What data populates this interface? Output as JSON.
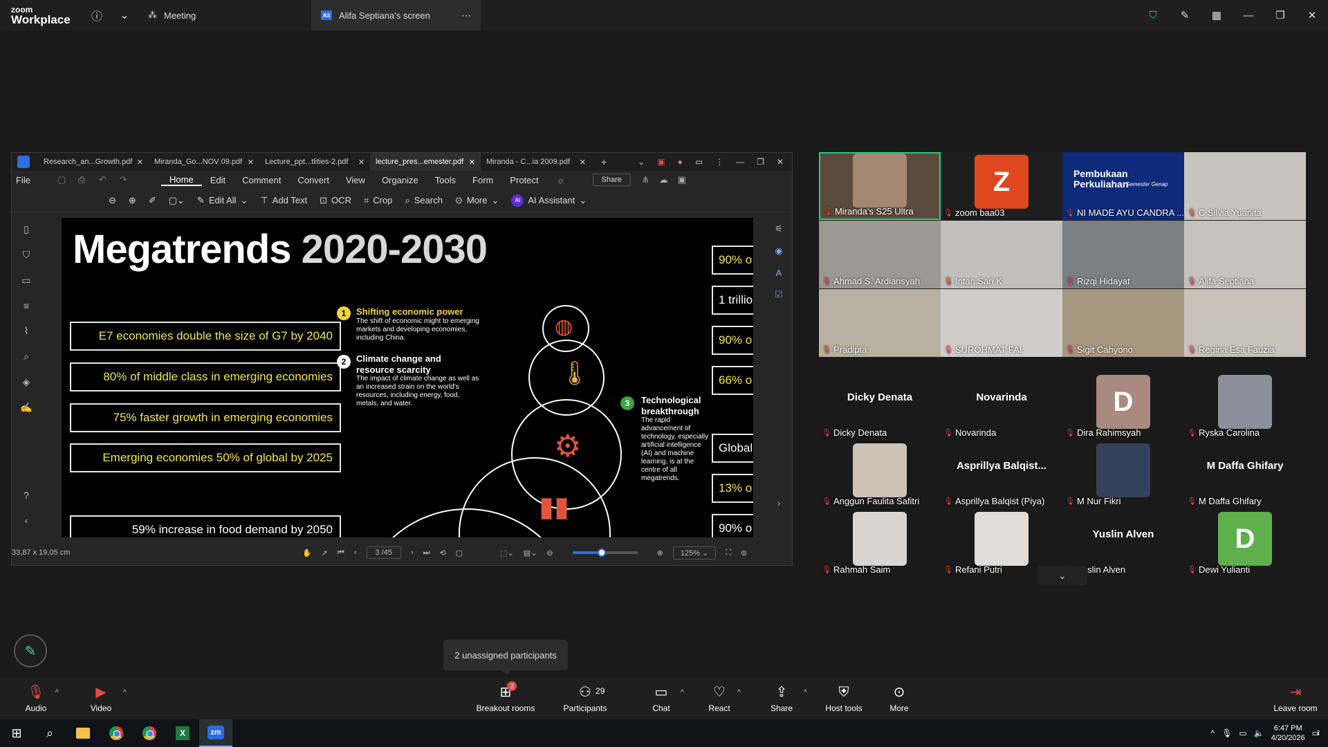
{
  "zoom": {
    "logo_line1": "zoom",
    "logo_line2": "Workplace",
    "tab_meeting": "Meeting",
    "tab_screen": "Alifa Septiana's screen",
    "screen_initials": "AS"
  },
  "pdf": {
    "tabs": [
      "Research_an...Growth.pdf",
      "Miranda_Go...NOV 09.pdf",
      "Lecture_ppt...tlities-2.pdf",
      "lecture_pres...emester.pdf",
      "Miranda - C...ia 2009.pdf"
    ],
    "menu": {
      "file": "File",
      "items": [
        "Home",
        "Edit",
        "Comment",
        "Convert",
        "View",
        "Organize",
        "Tools",
        "Form",
        "Protect"
      ],
      "share": "Share"
    },
    "tools": {
      "edit_all": "Edit All",
      "add_text": "Add Text",
      "ocr": "OCR",
      "crop": "Crop",
      "search": "Search",
      "more": "More",
      "ai_badge": "AI",
      "ai_assistant": "AI Assistant"
    },
    "status": {
      "dimensions": "33,87 x 19,05 cm",
      "page": "3 /45",
      "zoom": "125%",
      "zoom_level": 0.45
    }
  },
  "slide": {
    "title_main": "Megatrends ",
    "title_years": "2020-2030",
    "left_boxes": [
      "E7 economies double the size of G7 by 2040",
      "80% of middle class in emerging economies",
      "75% faster growth in emerging economies",
      "Emerging economies 50% of global by 2025",
      "59% increase in food demand by 2050"
    ],
    "points": [
      {
        "num": "1",
        "title": "Shifting economic power",
        "body": "The shift of economic might to emerging markets and developing economies, including China."
      },
      {
        "num": "2",
        "title": "Climate change and resource scarcity",
        "body": "The impact of climate change as well as an increased strain on the world's resources, including energy, food, metals, and water."
      },
      {
        "num": "3",
        "title": "Technological breakthrough",
        "body": "The rapid advancement of technology, especially artificial intelligence (AI) and machine learning, is at the centre of all megatrends."
      }
    ],
    "right_boxes": [
      "90% o",
      "1 trillio",
      "90% o",
      "66% o",
      "Global",
      "13% o",
      "90% o"
    ]
  },
  "gallery": {
    "video_tiles": [
      {
        "name": "Miranda's S25 Ultra"
      },
      {
        "name": "zoom baa03",
        "initial": "Z"
      },
      {
        "name": "NI MADE AYU CANDRA ...",
        "slide_title": "Pembukaan Perkuliahan",
        "slide_sub": "Semester Genap"
      },
      {
        "name": "C Silvia Yuanita"
      },
      {
        "name": "Ahmad S. Ardiansyah"
      },
      {
        "name": "Intan Sari K"
      },
      {
        "name": "Rizqi Hidayat"
      },
      {
        "name": "Alifa Septiana"
      },
      {
        "name": "Pradipta"
      },
      {
        "name": "SUROHMAT FAI"
      },
      {
        "name": "Sigit Cahyono"
      },
      {
        "name": "Regina Esa Fauzia"
      }
    ],
    "avatar_tiles": [
      {
        "name": "Dicky Denata",
        "big": "Dicky Denata"
      },
      {
        "name": "Novarinda",
        "big": "Novarinda"
      },
      {
        "name": "Dira Rahimsyah",
        "initial": "D"
      },
      {
        "name": "Ryska Carolina"
      },
      {
        "name": "Anggun Faulita Safitri"
      },
      {
        "name": "Asprillya Balqist (Piya)",
        "big": "Asprillya  Balqist..."
      },
      {
        "name": "M Nur Fikri"
      },
      {
        "name": "M Daffa Ghifary",
        "big": "M Daffa Ghifary"
      },
      {
        "name": "Rahmah Saim"
      },
      {
        "name": "Refani Putri"
      },
      {
        "name": "Yuslin Alven",
        "big": "Yuslin Alven"
      },
      {
        "name": "Dewi Yulianti",
        "initial": "D"
      }
    ]
  },
  "tooltip": "2 unassigned participants",
  "toolbar": {
    "audio": "Audio",
    "video": "Video",
    "breakout": "Breakout rooms",
    "breakout_badge": "2",
    "participants": "Participants",
    "participants_count": "29",
    "chat": "Chat",
    "react": "React",
    "share": "Share",
    "host_tools": "Host tools",
    "more": "More",
    "leave": "Leave room"
  },
  "taskbar": {
    "time": "6:47 PM",
    "date": "4/20/2026",
    "notif": "2"
  }
}
